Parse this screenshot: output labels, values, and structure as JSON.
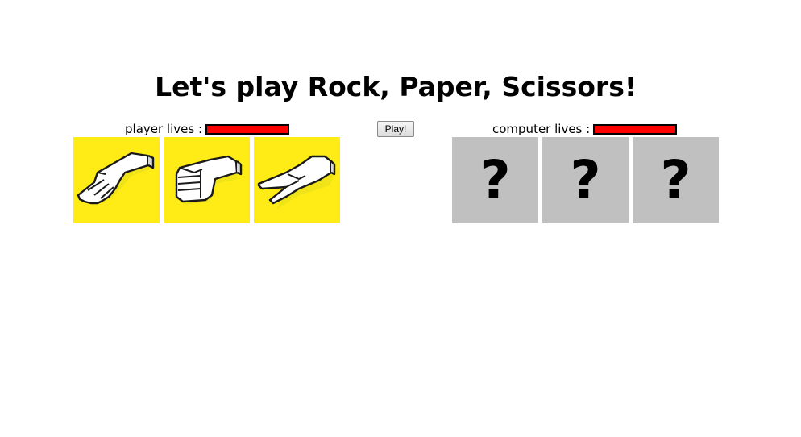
{
  "title": "Let's play Rock, Paper, Scissors!",
  "player": {
    "lives_label": "player lives :",
    "lives_fraction": 1.0,
    "choices": [
      "paper",
      "rock",
      "scissors"
    ]
  },
  "computer": {
    "lives_label": "computer lives :",
    "lives_fraction": 1.0,
    "hidden_choices": [
      "?",
      "?",
      "?"
    ]
  },
  "play_button": "Play!",
  "colors": {
    "choice_bg": "#ffec16",
    "mystery_bg": "#c0c0c0",
    "lives_bar": "#ff0000"
  },
  "icons": [
    "paper-hand-icon",
    "rock-fist-icon",
    "scissors-hand-icon"
  ]
}
